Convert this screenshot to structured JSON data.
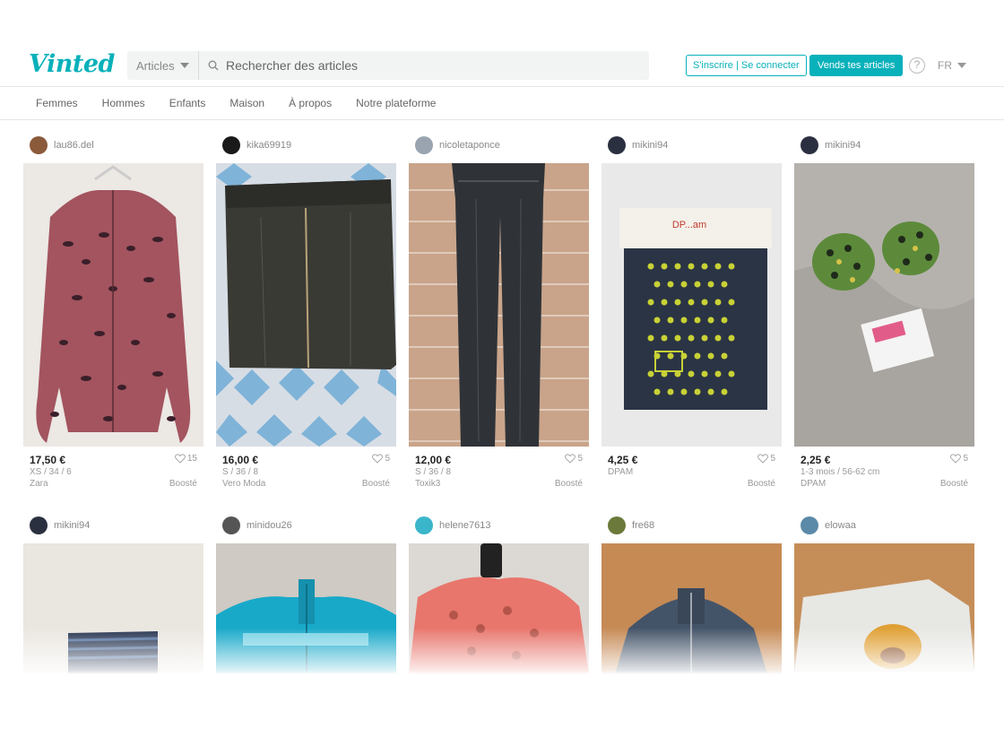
{
  "header": {
    "logo": "Vinted",
    "category_select": "Articles",
    "search_placeholder": "Rechercher des articles",
    "signup_label": "S'inscrire | Se connecter",
    "sell_label": "Vends tes articles",
    "help_label": "?",
    "language": "FR"
  },
  "nav": {
    "items": [
      "Femmes",
      "Hommes",
      "Enfants",
      "Maison",
      "À propos",
      "Notre plateforme"
    ]
  },
  "items": [
    {
      "user": "lau86.del",
      "price": "17,50 €",
      "size": "XS / 34 / 6",
      "brand": "Zara",
      "likes": "15",
      "boost": "Boosté",
      "avatar_color": "#8a5a3b"
    },
    {
      "user": "kika69919",
      "price": "16,00 €",
      "size": "S / 36 / 8",
      "brand": "Vero Moda",
      "likes": "5",
      "boost": "Boosté",
      "avatar_color": "#1a1a1a"
    },
    {
      "user": "nicoletaponce",
      "price": "12,00 €",
      "size": "S / 36 / 8",
      "brand": "Toxik3",
      "likes": "5",
      "boost": "Boosté",
      "avatar_color": "#9aa4b0"
    },
    {
      "user": "mikini94",
      "price": "4,25 €",
      "size": "DPAM",
      "brand": "",
      "likes": "5",
      "boost": "Boosté",
      "avatar_color": "#2b3040"
    },
    {
      "user": "mikini94",
      "price": "2,25 €",
      "size": "1-3 mois / 56-62 cm",
      "brand": "DPAM",
      "likes": "5",
      "boost": "Boosté",
      "avatar_color": "#2b3040"
    },
    {
      "user": "mikini94",
      "avatar_color": "#2b3040"
    },
    {
      "user": "minidou26",
      "avatar_color": "#555"
    },
    {
      "user": "helene7613",
      "avatar_color": "#3ab5c9"
    },
    {
      "user": "fre68",
      "avatar_color": "#6b7a3a"
    },
    {
      "user": "elowaa",
      "avatar_color": "#5b8aa8"
    }
  ]
}
